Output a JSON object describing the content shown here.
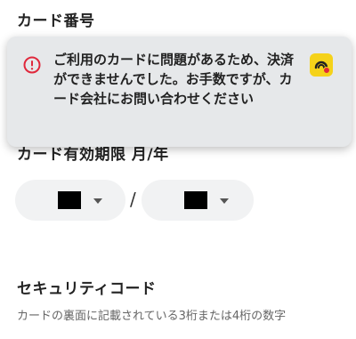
{
  "card_number": {
    "title": "カード番号"
  },
  "alert": {
    "message": "ご利用のカードに問題があるため、決済ができませんでした。お手数ですが、カード会社にお問い合わせください",
    "icon": "error-circle-icon",
    "app_icon": "app-badge-icon",
    "colors": {
      "background": "#e6e8ea",
      "error": "#e0283c",
      "badge": "#f5d21a"
    }
  },
  "expiry": {
    "title": "カード有効期限 月/年",
    "month_value": "■■",
    "year_value": "■■",
    "separator": "/"
  },
  "security": {
    "title": "セキュリティコード",
    "hint": "カードの裏面に記載されている3桁または4桁の数字"
  }
}
